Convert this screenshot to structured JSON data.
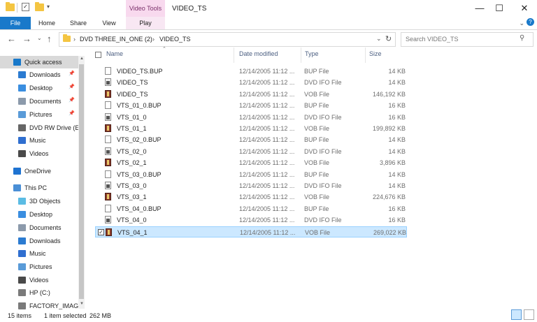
{
  "window": {
    "title": "VIDEO_TS",
    "context_tab": "Video Tools",
    "controls": [
      "—",
      "☐",
      "✕"
    ]
  },
  "ribbon": {
    "tabs": [
      "File",
      "Home",
      "Share",
      "View",
      "Play"
    ]
  },
  "address": {
    "path": [
      "DVD THREE_IN_ONE (2)",
      "VIDEO_TS"
    ],
    "search_placeholder": "Search VIDEO_TS"
  },
  "sidebar": {
    "items": [
      {
        "label": "Quick access",
        "icon": "star-icon",
        "pinned": false
      },
      {
        "label": "Downloads",
        "icon": "download-icon",
        "pinned": true
      },
      {
        "label": "Desktop",
        "icon": "desktop-icon",
        "pinned": true
      },
      {
        "label": "Documents",
        "icon": "documents-icon",
        "pinned": true
      },
      {
        "label": "Pictures",
        "icon": "pictures-icon",
        "pinned": true
      },
      {
        "label": "DVD RW Drive (E",
        "icon": "dvd-drive-icon",
        "pinned": false
      },
      {
        "label": "Music",
        "icon": "music-icon",
        "pinned": false
      },
      {
        "label": "Videos",
        "icon": "videos-icon",
        "pinned": false
      },
      {
        "label": "OneDrive",
        "icon": "onedrive-icon",
        "pinned": false
      },
      {
        "label": "This PC",
        "icon": "this-pc-icon",
        "pinned": false
      },
      {
        "label": "3D Objects",
        "icon": "3d-objects-icon",
        "pinned": false
      },
      {
        "label": "Desktop",
        "icon": "desktop-icon",
        "pinned": false
      },
      {
        "label": "Documents",
        "icon": "documents-icon",
        "pinned": false
      },
      {
        "label": "Downloads",
        "icon": "download-icon",
        "pinned": false
      },
      {
        "label": "Music",
        "icon": "music-icon",
        "pinned": false
      },
      {
        "label": "Pictures",
        "icon": "pictures-icon",
        "pinned": false
      },
      {
        "label": "Videos",
        "icon": "videos-icon",
        "pinned": false
      },
      {
        "label": "HP (C:)",
        "icon": "drive-icon",
        "pinned": false
      },
      {
        "label": "FACTORY_IMAG",
        "icon": "drive-icon",
        "pinned": false
      }
    ]
  },
  "columns": {
    "name": "Name",
    "date": "Date modified",
    "type": "Type",
    "size": "Size"
  },
  "files": [
    {
      "name": "VIDEO_TS.BUP",
      "date": "12/14/2005 11:12 ...",
      "type": "BUP File",
      "size": "14 KB",
      "kind": "bup"
    },
    {
      "name": "VIDEO_TS",
      "date": "12/14/2005 11:12 ...",
      "type": "DVD IFO File",
      "size": "14 KB",
      "kind": "ifo"
    },
    {
      "name": "VIDEO_TS",
      "date": "12/14/2005 11:12 ...",
      "type": "VOB File",
      "size": "146,192 KB",
      "kind": "vob"
    },
    {
      "name": "VTS_01_0.BUP",
      "date": "12/14/2005 11:12 ...",
      "type": "BUP File",
      "size": "16 KB",
      "kind": "bup"
    },
    {
      "name": "VTS_01_0",
      "date": "12/14/2005 11:12 ...",
      "type": "DVD IFO File",
      "size": "16 KB",
      "kind": "ifo"
    },
    {
      "name": "VTS_01_1",
      "date": "12/14/2005 11:12 ...",
      "type": "VOB File",
      "size": "199,892 KB",
      "kind": "vob"
    },
    {
      "name": "VTS_02_0.BUP",
      "date": "12/14/2005 11:12 ...",
      "type": "BUP File",
      "size": "14 KB",
      "kind": "bup"
    },
    {
      "name": "VTS_02_0",
      "date": "12/14/2005 11:12 ...",
      "type": "DVD IFO File",
      "size": "14 KB",
      "kind": "ifo"
    },
    {
      "name": "VTS_02_1",
      "date": "12/14/2005 11:12 ...",
      "type": "VOB File",
      "size": "3,896 KB",
      "kind": "vob"
    },
    {
      "name": "VTS_03_0.BUP",
      "date": "12/14/2005 11:12 ...",
      "type": "BUP File",
      "size": "14 KB",
      "kind": "bup"
    },
    {
      "name": "VTS_03_0",
      "date": "12/14/2005 11:12 ...",
      "type": "DVD IFO File",
      "size": "14 KB",
      "kind": "ifo"
    },
    {
      "name": "VTS_03_1",
      "date": "12/14/2005 11:12 ...",
      "type": "VOB File",
      "size": "224,676 KB",
      "kind": "vob"
    },
    {
      "name": "VTS_04_0.BUP",
      "date": "12/14/2005 11:12 ...",
      "type": "BUP File",
      "size": "16 KB",
      "kind": "bup"
    },
    {
      "name": "VTS_04_0",
      "date": "12/14/2005 11:12 ...",
      "type": "DVD IFO File",
      "size": "16 KB",
      "kind": "ifo"
    },
    {
      "name": "VTS_04_1",
      "date": "12/14/2005 11:12 ...",
      "type": "VOB File",
      "size": "269,022 KB",
      "kind": "vob",
      "selected": true
    }
  ],
  "status": {
    "count": "15 items",
    "selection": "1 item selected",
    "selection_size": "262 MB"
  },
  "colors": {
    "accent": "#1979ca",
    "selection_bg": "#cce8ff",
    "context_tab_bg": "#f8d9ee"
  }
}
